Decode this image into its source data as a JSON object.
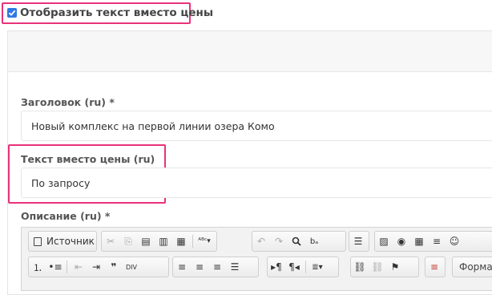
{
  "checkbox": {
    "label": "Отобразить текст вместо цены",
    "checked": true
  },
  "fields": {
    "title_label": "Заголовок (ru) *",
    "title_value": "Новый комплекс на первой линии озера Комо",
    "price_text_label": "Текст вместо цены (ru)",
    "price_text_value": "По запросу",
    "description_label": "Описание (ru) *"
  },
  "editor": {
    "source_label": "Источник",
    "format_label": "Формат"
  },
  "colors": {
    "highlight": "#e8327a",
    "checkbox": "#2f7ae5"
  }
}
